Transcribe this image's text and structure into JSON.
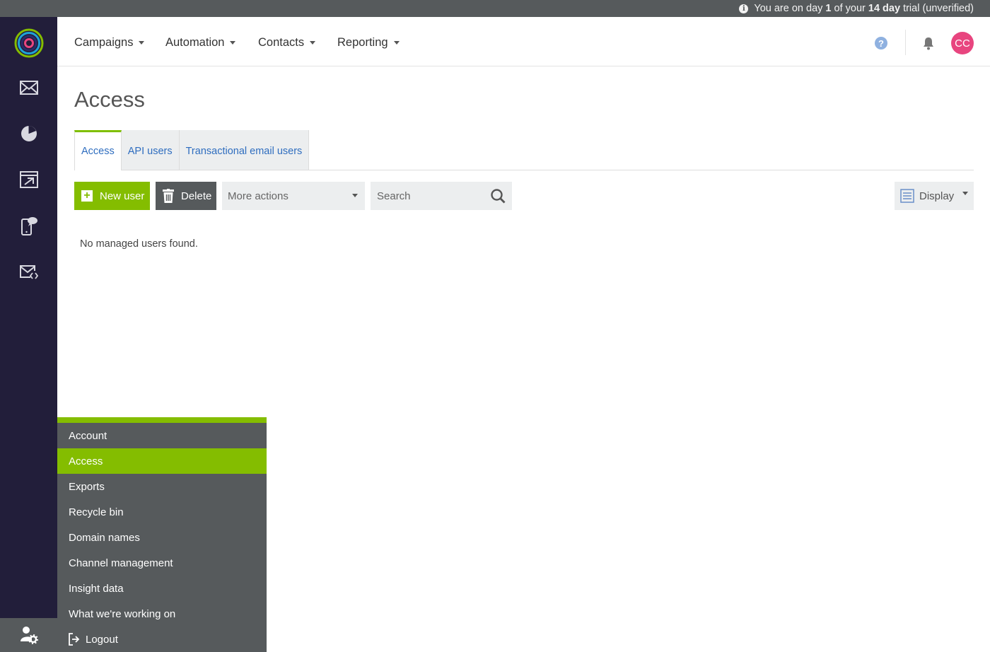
{
  "trial": {
    "prefix": "You are on day ",
    "day": "1",
    "middle": " of your ",
    "length": "14 day",
    "suffix": " trial (unverified)"
  },
  "rail": {
    "icons": [
      "logo-icon",
      "envelope-icon",
      "pie-chart-icon",
      "automation-icon",
      "sms-icon",
      "transactional-email-icon",
      "user-settings-icon"
    ]
  },
  "nav": {
    "items": [
      {
        "label": "Campaigns"
      },
      {
        "label": "Automation"
      },
      {
        "label": "Contacts"
      },
      {
        "label": "Reporting"
      }
    ],
    "help": "?",
    "avatar_initials": "CC",
    "accent": "#e8457f"
  },
  "page": {
    "title": "Access",
    "tabs": [
      {
        "label": "Access",
        "active": true
      },
      {
        "label": "API users",
        "active": false
      },
      {
        "label": "Transactional email users",
        "active": false
      }
    ]
  },
  "toolbar": {
    "new_user": "New user",
    "delete": "Delete",
    "more_actions": "More actions",
    "search_placeholder": "Search",
    "display": "Display"
  },
  "empty_message": "No managed users found.",
  "settings_menu": {
    "items": [
      {
        "label": "Account",
        "active": false
      },
      {
        "label": "Access",
        "active": true
      },
      {
        "label": "Exports",
        "active": false
      },
      {
        "label": "Recycle bin",
        "active": false
      },
      {
        "label": "Domain names",
        "active": false
      },
      {
        "label": "Channel management",
        "active": false
      },
      {
        "label": "Insight data",
        "active": false
      },
      {
        "label": "What we're working on",
        "active": false
      },
      {
        "label": "Logout",
        "active": false
      }
    ]
  },
  "colors": {
    "brand_green": "#84bd00",
    "rail_bg": "#221e3a",
    "menu_bg": "#565a5c",
    "link_blue": "#2e6dbf"
  }
}
